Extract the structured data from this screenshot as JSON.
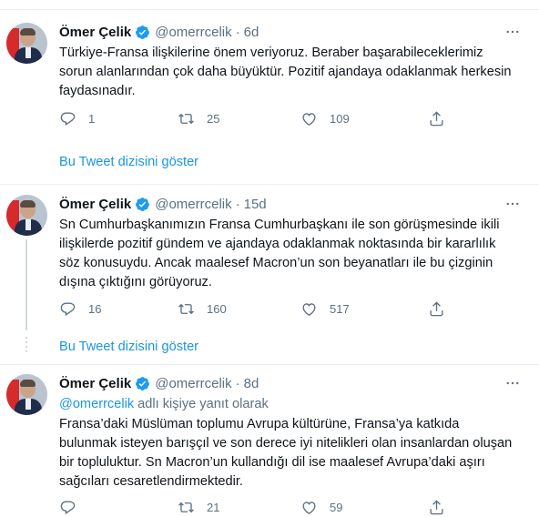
{
  "tweets": [
    {
      "name": "Ömer Çelik",
      "handle": "@omerrcelik",
      "separator": "·",
      "time": "6d",
      "text_lines": [
        "Türkiye-Fransa ilişkilerine önem veriyoruz. Beraber başarabileceklerimiz",
        "sorun alanlarından çok daha büyüktür. Pozitif ajandaya odaklanmak herkesin",
        "faydasınadır."
      ],
      "replies": "1",
      "retweets": "25",
      "likes": "109",
      "show_thread": "Bu Tweet dizisini göster"
    },
    {
      "name": "Ömer Çelik",
      "handle": "@omerrcelik",
      "separator": "·",
      "time": "15d",
      "text_lines": [
        "Sn Cumhurbaşkanımızın Fransa Cumhurbaşkanı ile son görüşmesinde ikili",
        "ilişkilerde pozitif gündem ve ajandaya odaklanmak noktasında bir kararlılık",
        "söz konusuydu. Ancak maalesef Macron’un son beyanatları ile bu çizginin",
        "dışına çıktığını görüyoruz."
      ],
      "replies": "16",
      "retweets": "160",
      "likes": "517",
      "show_thread": "Bu Tweet dizisini göster"
    },
    {
      "name": "Ömer Çelik",
      "handle": "@omerrcelik",
      "separator": "·",
      "time": "8d",
      "reply_mention": "@omerrcelik",
      "reply_rest": " adlı kişiye yanıt olarak",
      "text_lines": [
        "Fransa’daki Müslüman toplumu Avrupa kültürüne, Fransa’ya katkıda",
        "bulunmak isteyen barışçıl ve son derece iyi nitelikleri olan insanlardan oluşan",
        "bir topluluktur. Sn Macron’un kullandığı dil ise maalesef Avrupa’daki aşırı",
        "sağcıları cesaretlendirmektedir."
      ],
      "replies": "",
      "retweets": "21",
      "likes": "59"
    }
  ],
  "colors": {
    "accent": "#1b95e0",
    "muted": "#5b7083",
    "border": "#ebeef0"
  },
  "icons": [
    "verified-badge-icon",
    "more-icon",
    "reply-icon",
    "retweet-icon",
    "like-icon",
    "share-icon"
  ]
}
